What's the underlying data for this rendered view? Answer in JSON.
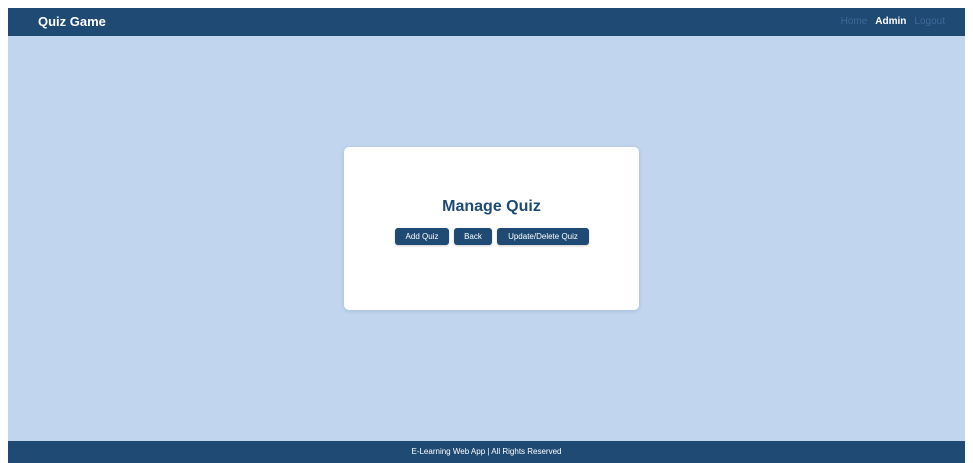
{
  "navbar": {
    "brand": "Quiz Game",
    "links": [
      {
        "label": "Home",
        "active": false
      },
      {
        "label": "Admin",
        "active": true
      },
      {
        "label": "Logout",
        "active": false
      }
    ]
  },
  "main": {
    "title": "Manage Quiz",
    "buttons": {
      "add_quiz": "Add Quiz",
      "back": "Back",
      "update_delete": "Update/Delete Quiz"
    }
  },
  "footer": {
    "text": "E-Learning Web App | All Rights Reserved"
  },
  "colors": {
    "primary": "#1e4a74",
    "background": "#c2d5ee",
    "card": "#ffffff",
    "nav_inactive": "#3b6b98"
  }
}
